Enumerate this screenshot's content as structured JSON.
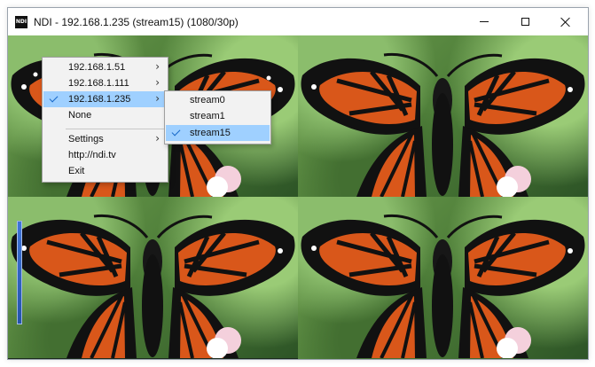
{
  "window": {
    "title": "NDI - 192.168.1.235 (stream15) (1080/30p)",
    "icon_name": "ndi-app-icon",
    "icon_text": "NDI"
  },
  "window_controls": {
    "minimize_icon": "minimize-icon",
    "maximize_icon": "maximize-icon",
    "close_icon": "close-icon"
  },
  "context_menu": {
    "items": [
      {
        "label": "192.168.1.51",
        "has_submenu": true,
        "checked": false,
        "selected": false
      },
      {
        "label": "192.168.1.111",
        "has_submenu": true,
        "checked": false,
        "selected": false
      },
      {
        "label": "192.168.1.235",
        "has_submenu": true,
        "checked": true,
        "selected": true
      },
      {
        "label": "None",
        "has_submenu": false,
        "checked": false,
        "selected": false
      },
      {
        "label": "Settings",
        "has_submenu": true,
        "checked": false,
        "selected": false
      },
      {
        "label": "http://ndi.tv",
        "has_submenu": false,
        "checked": false,
        "selected": false
      },
      {
        "label": "Exit",
        "has_submenu": false,
        "checked": false,
        "selected": false
      }
    ],
    "submenu_arrow": "›"
  },
  "submenu": {
    "items": [
      {
        "label": "stream0",
        "checked": false,
        "selected": false
      },
      {
        "label": "stream1",
        "checked": false,
        "selected": false
      },
      {
        "label": "stream15",
        "checked": true,
        "selected": true
      }
    ]
  },
  "video": {
    "tile_count": 4,
    "subject": "monarch-butterfly",
    "side_indicator": "volume-level-indicator"
  },
  "colors": {
    "menu_highlight": "#9fd0ff",
    "check": "#1768c8",
    "butterfly_orange": "#d9571a",
    "butterfly_black": "#111111",
    "side_indicator_blue": "#2f65c9"
  }
}
